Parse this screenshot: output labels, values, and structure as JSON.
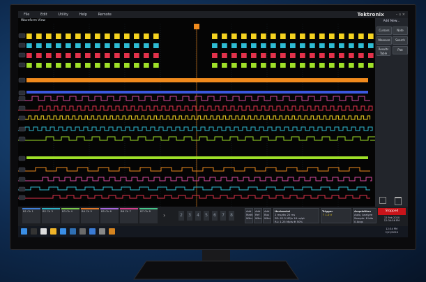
{
  "menu": [
    "File",
    "Edit",
    "Utility",
    "Help",
    "Remote"
  ],
  "brand": "Tektronix",
  "window_controls": "– ▫ ×",
  "waveform_view_title": "Waveform View",
  "side_panel": {
    "add_new": "Add New...",
    "buttons": [
      "Cursors",
      "Note",
      "Measure",
      "Search",
      "Results Table",
      "Plot"
    ]
  },
  "bottom": {
    "channel_badges": [
      {
        "label": "B1 Ch 1",
        "color": "#3f80d8"
      },
      {
        "label": "B2 Ch 3",
        "color": "#2db3c7"
      },
      {
        "label": "B3 Ch 4",
        "color": "#7cc94a"
      },
      {
        "label": "B4 Ch 5",
        "color": "#e37a2a"
      },
      {
        "label": "B5 Ch 6",
        "color": "#aa66dd"
      },
      {
        "label": "B6 Ch 7",
        "color": "#d43f8d"
      },
      {
        "label": "B7 Ch 8",
        "color": "#47c68a"
      }
    ],
    "numbers": [
      "2",
      "3",
      "4",
      "5",
      "6",
      "7",
      "8"
    ],
    "add_buttons": [
      "Add Math Wfm",
      "Add Ref Wfm",
      "Add Bus Wfm"
    ],
    "horizontal": {
      "title": "Horizontal",
      "lines": [
        "2 ms/div    20 ms",
        "SR: 62.5 MS/s    16 ns/pt",
        "RL: 1.25 Mpts    ⊕ 50%"
      ]
    },
    "trigger": {
      "title": "Trigger",
      "lines": [
        "↑  1.0 V"
      ]
    },
    "acquisition": {
      "title": "Acquisition",
      "lines": [
        "Auto,    Analyze",
        "Sample: 8 bits",
        "0 Acqs"
      ]
    },
    "stopped": "Stopped",
    "date_block": "12 Feb 2020\n12:34:56 PM"
  },
  "taskbar": {
    "clock": "12:34 PM\n2/12/2020"
  },
  "colors": {
    "yellow": "#f4d21f",
    "cyan": "#2fbcd3",
    "red": "#e2324b",
    "lime": "#9fe028",
    "orange": "#f08a1d",
    "blue": "#3b58e0",
    "pink": "#d94aa0"
  }
}
